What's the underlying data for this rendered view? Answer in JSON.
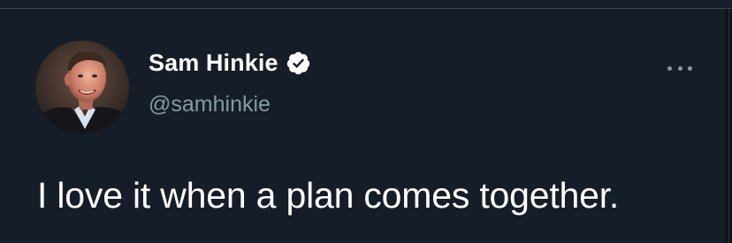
{
  "tweet": {
    "author": {
      "display_name": "Sam Hinkie",
      "handle": "@samhinkie",
      "verified": true
    },
    "text": "I love it when a plan comes together.",
    "icons": {
      "verified": "verified-badge-icon",
      "more": "more-options-icon"
    }
  },
  "colors": {
    "background": "#151d28",
    "primary_text": "#ffffff",
    "secondary_text": "#8899a6",
    "verified_badge": "#ffffff"
  }
}
